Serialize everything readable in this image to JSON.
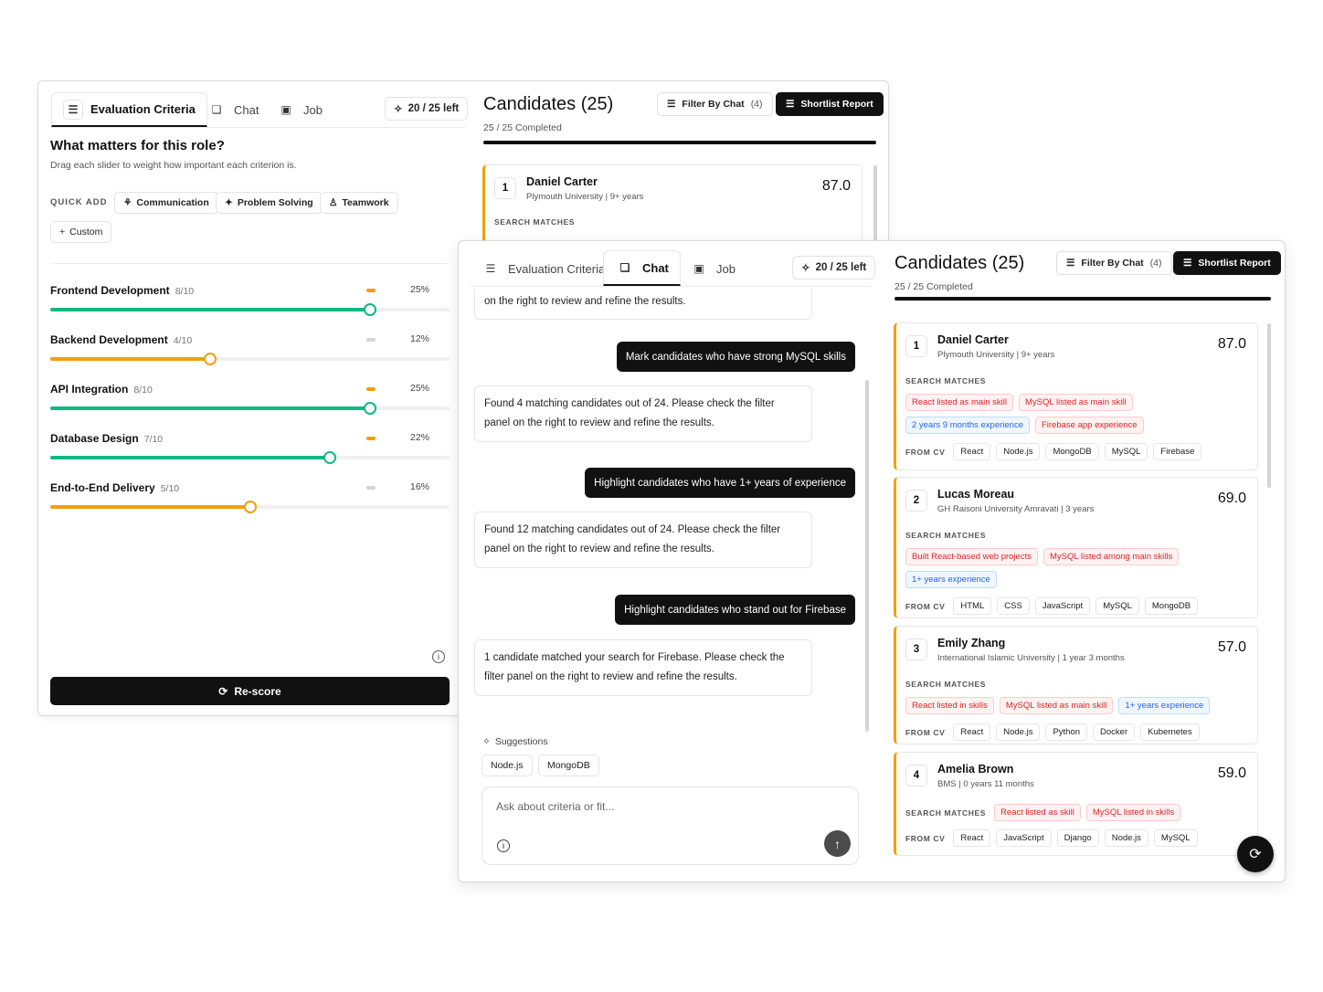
{
  "left_panel": {
    "tabs": [
      {
        "label": "Evaluation Criteria",
        "icon": "sliders-icon"
      },
      {
        "label": "Chat",
        "icon": "chat-icon"
      },
      {
        "label": "Job",
        "icon": "briefcase-icon"
      }
    ],
    "credits": "20 / 25 left",
    "heading": "What matters for this role?",
    "subheading": "Drag each slider to weight how important each criterion is.",
    "quick_add_label": "QUICK ADD",
    "quick_add": [
      "Communication",
      "Problem Solving",
      "Teamwork"
    ],
    "custom_label": "Custom",
    "criteria": [
      {
        "name": "Frontend Development",
        "score": "8/10",
        "pct": "25%",
        "value": 0.8,
        "color": "#10b981",
        "mini": "#f59e0b"
      },
      {
        "name": "Backend Development",
        "score": "4/10",
        "pct": "12%",
        "value": 0.4,
        "color": "#f59e0b",
        "mini": "#d4d4d4"
      },
      {
        "name": "API Integration",
        "score": "8/10",
        "pct": "25%",
        "value": 0.8,
        "color": "#10b981",
        "mini": "#f59e0b"
      },
      {
        "name": "Database Design",
        "score": "7/10",
        "pct": "22%",
        "value": 0.7,
        "color": "#10b981",
        "mini": "#f59e0b"
      },
      {
        "name": "End-to-End Delivery",
        "score": "5/10",
        "pct": "16%",
        "value": 0.5,
        "color": "#f59e0b",
        "mini": "#d4d4d4"
      }
    ],
    "rescore_label": "Re-score"
  },
  "back_candidates": {
    "title": "Candidates (25)",
    "completed": "25 / 25 Completed",
    "filter_label": "Filter By Chat",
    "filter_count": "(4)",
    "shortlist_label": "Shortlist Report",
    "card": {
      "rank": "1",
      "name": "Daniel Carter",
      "inst": "Plymouth University | 9+ years",
      "score": "87.0",
      "search_label": "SEARCH MATCHES"
    }
  },
  "chat": {
    "messages": [
      {
        "role": "bot",
        "text": "on the right to review and refine the results."
      },
      {
        "role": "user",
        "text": "Mark candidates who have strong MySQL skills"
      },
      {
        "role": "bot",
        "text": "Found 4 matching candidates out of 24. Please check the filter panel on the right to review and refine the results."
      },
      {
        "role": "user",
        "text": "Highlight candidates who have 1+ years of experience"
      },
      {
        "role": "bot",
        "text": "Found 12 matching candidates out of 24. Please check the filter panel on the right to review and refine the results."
      },
      {
        "role": "user",
        "text": "Highlight candidates who stand out for Firebase"
      },
      {
        "role": "bot",
        "text": "1 candidate matched your search for Firebase. Please check the filter panel on the right to review and refine the results."
      }
    ],
    "suggestions_label": "Suggestions",
    "suggestions": [
      "Node.js",
      "MongoDB"
    ],
    "input_placeholder": "Ask about criteria or fit..."
  },
  "front_candidates": {
    "title": "Candidates (25)",
    "completed": "25 / 25 Completed",
    "filter_label": "Filter By Chat",
    "filter_count": "(4)",
    "shortlist_label": "Shortlist Report",
    "search_label": "SEARCH MATCHES",
    "cv_label": "FROM CV",
    "cards": [
      {
        "rank": "1",
        "name": "Daniel Carter",
        "inst": "Plymouth University | 9+ years",
        "score": "87.0",
        "tag_rows": [
          [
            {
              "t": "React listed as main skill",
              "c": "red"
            },
            {
              "t": "MySQL listed as main skill",
              "c": "red"
            }
          ],
          [
            {
              "t": "2 years 9 months experience",
              "c": "blue"
            },
            {
              "t": "Firebase app experience",
              "c": "red"
            }
          ]
        ],
        "cv": [
          "React",
          "Node.js",
          "MongoDB",
          "MySQL",
          "Firebase"
        ]
      },
      {
        "rank": "2",
        "name": "Lucas Moreau",
        "inst": "GH Raisoni University Amravati | 3 years",
        "score": "69.0",
        "tag_rows": [
          [
            {
              "t": "Built React-based web projects",
              "c": "red"
            },
            {
              "t": "MySQL listed among main skills",
              "c": "red"
            }
          ],
          [
            {
              "t": "1+ years experience",
              "c": "blue"
            }
          ]
        ],
        "cv": [
          "HTML",
          "CSS",
          "JavaScript",
          "MySQL",
          "MongoDB"
        ]
      },
      {
        "rank": "3",
        "name": "Emily Zhang",
        "inst": "International Islamic University | 1 year 3 months",
        "score": "57.0",
        "tag_rows": [
          [
            {
              "t": "React listed in skills",
              "c": "red"
            },
            {
              "t": "MySQL listed as main skill",
              "c": "red"
            },
            {
              "t": "1+ years experience",
              "c": "blue"
            }
          ]
        ],
        "cv": [
          "React",
          "Node.js",
          "Python",
          "Docker",
          "Kubernetes"
        ]
      },
      {
        "rank": "4",
        "name": "Amelia Brown",
        "inst": "BMS | 0 years 11 months",
        "score": "59.0",
        "tag_rows": [
          [
            {
              "t": "React listed as skill",
              "c": "red"
            },
            {
              "t": "MySQL listed in skills",
              "c": "red"
            }
          ]
        ],
        "cv": [
          "React",
          "JavaScript",
          "Django",
          "Node.js",
          "MySQL"
        ]
      }
    ]
  },
  "colors": {
    "accent_orange": "#f59e0b",
    "accent_green": "#10b981",
    "dark": "#111111"
  }
}
